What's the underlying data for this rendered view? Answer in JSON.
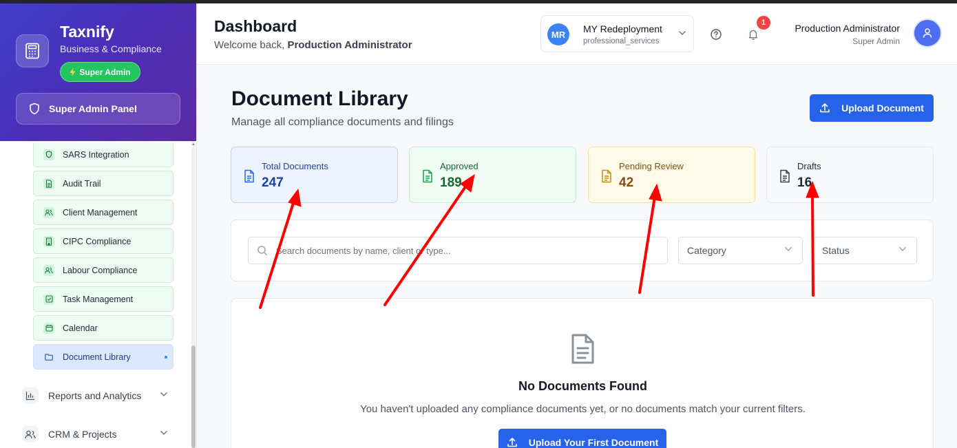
{
  "brand": {
    "name": "Taxnify",
    "subtitle": "Business & Compliance",
    "badge": "Super Admin",
    "panel_label": "Super Admin Panel"
  },
  "sidebar": {
    "items": [
      {
        "label": "SARS Integration",
        "icon": "shield-icon"
      },
      {
        "label": "Audit Trail",
        "icon": "file-icon"
      },
      {
        "label": "Client Management",
        "icon": "users-icon"
      },
      {
        "label": "CIPC Compliance",
        "icon": "building-icon"
      },
      {
        "label": "Labour Compliance",
        "icon": "users-icon"
      },
      {
        "label": "Task Management",
        "icon": "checkbox-icon"
      },
      {
        "label": "Calendar",
        "icon": "calendar-icon"
      },
      {
        "label": "Document Library",
        "icon": "folder-icon",
        "active": true
      }
    ],
    "sections": [
      {
        "label": "Reports and Analytics",
        "icon": "bar-chart-icon"
      },
      {
        "label": "CRM & Projects",
        "icon": "users-icon"
      }
    ]
  },
  "header": {
    "title": "Dashboard",
    "welcome_prefix": "Welcome back,",
    "welcome_name": "Production Administrator",
    "org": {
      "initials": "MR",
      "name": "MY Redeployment",
      "type": "professional_services"
    },
    "notification_count": "1",
    "user": {
      "name": "Production Administrator",
      "role": "Super Admin"
    }
  },
  "main": {
    "title": "Document Library",
    "subtitle": "Manage all compliance documents and filings",
    "upload_label": "Upload Document",
    "stats": [
      {
        "label": "Total Documents",
        "value": "247"
      },
      {
        "label": "Approved",
        "value": "189"
      },
      {
        "label": "Pending Review",
        "value": "42"
      },
      {
        "label": "Drafts",
        "value": "16"
      }
    ],
    "search_placeholder": "Search documents by name, client or type...",
    "category_label": "Category",
    "status_label": "Status",
    "empty": {
      "title": "No Documents Found",
      "text": "You haven't uploaded any compliance documents yet, or no documents match your current filters.",
      "button": "Upload Your First Document"
    }
  },
  "colors": {
    "accent": "#2563eb",
    "annotation_arrow": "#ff0000",
    "badge_green": "#22c55e",
    "notification": "#ef4444"
  }
}
